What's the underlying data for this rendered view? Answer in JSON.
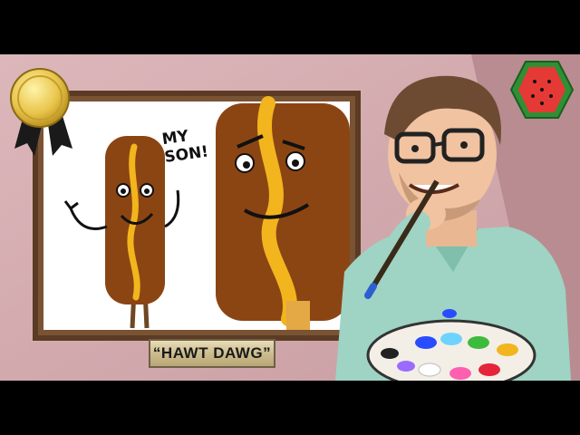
{
  "artwork": {
    "speech_text": "MY SON!",
    "plaque_text": "“HAWT DAWG”"
  },
  "icons": [
    "gold-medal-ribbon-icon",
    "watermelon-logo-icon"
  ],
  "colors": {
    "wall": "#d6b1b4",
    "frame": "#6b4a2f",
    "canvas": "#ffffff",
    "hotdog_brown": "#8b4513",
    "mustard": "#f2b51d",
    "shirt": "#9fd3c3",
    "skin": "#f1c3a0",
    "hair": "#6d4b33",
    "logo_green": "#36a33b",
    "logo_red": "#e53935"
  }
}
